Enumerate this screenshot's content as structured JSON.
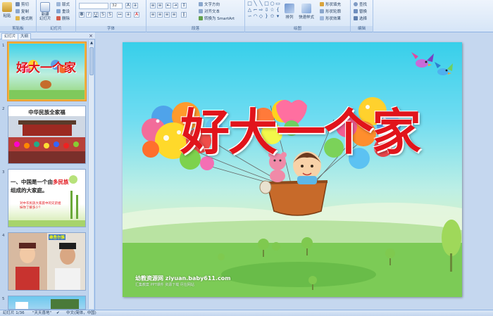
{
  "ribbon": {
    "clipboard": {
      "paste": "粘贴",
      "cut": "剪切",
      "copy": "复制",
      "format_painter": "格式刷",
      "label": "剪贴板"
    },
    "slides": {
      "new_slide": "新建\n幻灯片",
      "layout": "版式",
      "reset": "重设",
      "delete": "删除",
      "label": "幻灯片"
    },
    "font": {
      "font_size": "32",
      "label": "字体"
    },
    "paragraph": {
      "text_direction": "文字方向",
      "align_text": "对齐文本",
      "smartart": "转换为 SmartArt",
      "label": "段落"
    },
    "drawing": {
      "arrange": "排列",
      "quick_styles": "快速样式",
      "shape_fill": "形状填充",
      "shape_outline": "形状轮廓",
      "shape_effects": "形状效果",
      "label": "绘图"
    },
    "editing": {
      "find": "查找",
      "replace": "替换",
      "select": "选择",
      "label": "编辑"
    }
  },
  "panel": {
    "tabs": [
      "幻灯片",
      "大纲"
    ],
    "close": "×",
    "thumbnails": [
      {
        "num": "1",
        "title": "好大一个家"
      },
      {
        "num": "2",
        "title": "中华民族全家福"
      },
      {
        "num": "3",
        "line1": "一、中国是一个由",
        "highlight": "多民族",
        "line2": "组成的大家庭。",
        "question": "对中华民族大家庭中的兄弟姐妹你了解多少？"
      },
      {
        "num": "4",
        "badge": "维吾尔族"
      },
      {
        "num": "5"
      }
    ]
  },
  "slide": {
    "title": "好大一个家",
    "watermark": "幼教资源网 ziyuan.baby611.com",
    "watermark_sub": "汇集教案 PPT课件 资源下载 尽在网站"
  },
  "status": {
    "slide_counter": "幻灯片 1/36",
    "theme": "\"天天喜地\"",
    "language": "中文(简体，中国)"
  },
  "colors": {
    "title_red": "#e1141b",
    "ribbon_bg": "#d6e5f7",
    "selection_orange": "#f0b23c"
  }
}
